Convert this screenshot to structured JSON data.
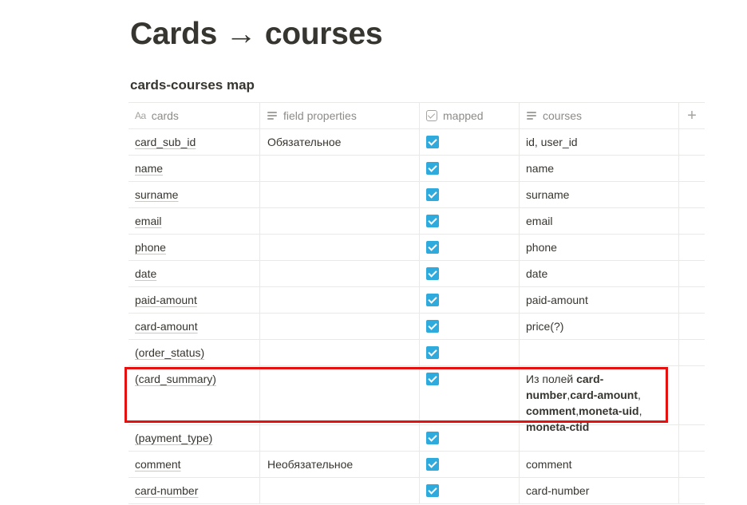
{
  "page": {
    "title": "Cards → courses",
    "view_title": "cards-courses map"
  },
  "table": {
    "columns": [
      {
        "label": "cards",
        "icon": "text-aa-icon"
      },
      {
        "label": "field properties",
        "icon": "lines-icon"
      },
      {
        "label": "mapped",
        "icon": "checkbox-icon"
      },
      {
        "label": "courses",
        "icon": "lines-icon"
      }
    ],
    "add_column_label": "+",
    "rows": [
      {
        "name": "card_sub_id",
        "props": "Обязательное",
        "mapped": true,
        "course": "id, user_id"
      },
      {
        "name": "name",
        "props": "",
        "mapped": true,
        "course": "name"
      },
      {
        "name": "surname",
        "props": "",
        "mapped": true,
        "course": "surname"
      },
      {
        "name": "email",
        "props": "",
        "mapped": true,
        "course": "email"
      },
      {
        "name": "phone",
        "props": "",
        "mapped": true,
        "course": "phone"
      },
      {
        "name": "date",
        "props": "",
        "mapped": true,
        "course": "date"
      },
      {
        "name": "paid-amount",
        "props": "",
        "mapped": true,
        "course": "paid-amount"
      },
      {
        "name": "card-amount",
        "props": "",
        "mapped": true,
        "course": "price(?)"
      },
      {
        "name": "(order_status)",
        "props": "",
        "mapped": true,
        "course": ""
      },
      {
        "name": "(card_summary)",
        "props": "",
        "mapped": true,
        "course_rich": {
          "prefix": "Из полей ",
          "f1": "card-number",
          "sep1": ",",
          "f2": "card-amount",
          "sep2": ", ",
          "f3": "comment",
          "sep3": ",",
          "f4": "moneta-uid",
          "sep4": ", ",
          "f5": "moneta-ctid"
        }
      },
      {
        "name": "(payment_type)",
        "props": "",
        "mapped": true,
        "course": ""
      },
      {
        "name": "comment",
        "props": "Необязательное",
        "mapped": true,
        "course": "comment"
      },
      {
        "name": "card-number",
        "props": "",
        "mapped": true,
        "course": "card-number"
      }
    ]
  },
  "highlight": {
    "color": "#e51010"
  },
  "colors": {
    "accent_checkbox": "#2eaadc",
    "text": "#37352f",
    "muted": "#8d8b87",
    "border": "#e9e9e7"
  }
}
